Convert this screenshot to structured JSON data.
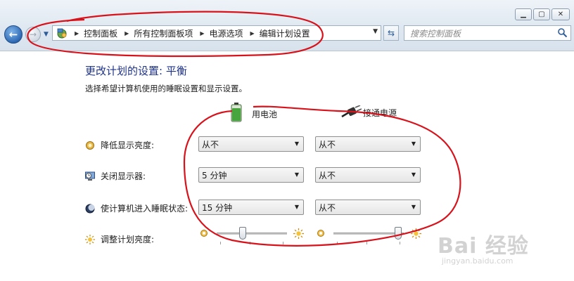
{
  "window": {
    "min_label": "▁",
    "max_label": "▢",
    "close_label": "✕"
  },
  "address_bar": {
    "breadcrumbs": [
      "控制面板",
      "所有控制面板项",
      "电源选项",
      "编辑计划设置"
    ]
  },
  "search": {
    "placeholder": "搜索控制面板"
  },
  "content": {
    "title": "更改计划的设置: 平衡",
    "subtitle": "选择希望计算机使用的睡眠设置和显示设置。",
    "columns": {
      "battery": "用电池",
      "plugged": "接通电源"
    },
    "rows": [
      {
        "label": "降低显示亮度:",
        "icon": "brightness-dim-icon",
        "battery": "从不",
        "plugged": "从不"
      },
      {
        "label": "关闭显示器:",
        "icon": "monitor-clock-icon",
        "battery": "5 分钟",
        "plugged": "从不"
      },
      {
        "label": "使计算机进入睡眠状态:",
        "icon": "sleep-moon-icon",
        "battery": "15 分钟",
        "plugged": "从不"
      }
    ],
    "brightness": {
      "label": "调整计划亮度:",
      "battery_level": 0.35,
      "plugged_level": 0.97
    }
  },
  "watermark": {
    "main": "Bai 经验",
    "sub": "jingyan.baidu.com"
  },
  "colors": {
    "title": "#1e3287",
    "annotation": "#d8121b",
    "chrome": "#dfe8f1"
  }
}
